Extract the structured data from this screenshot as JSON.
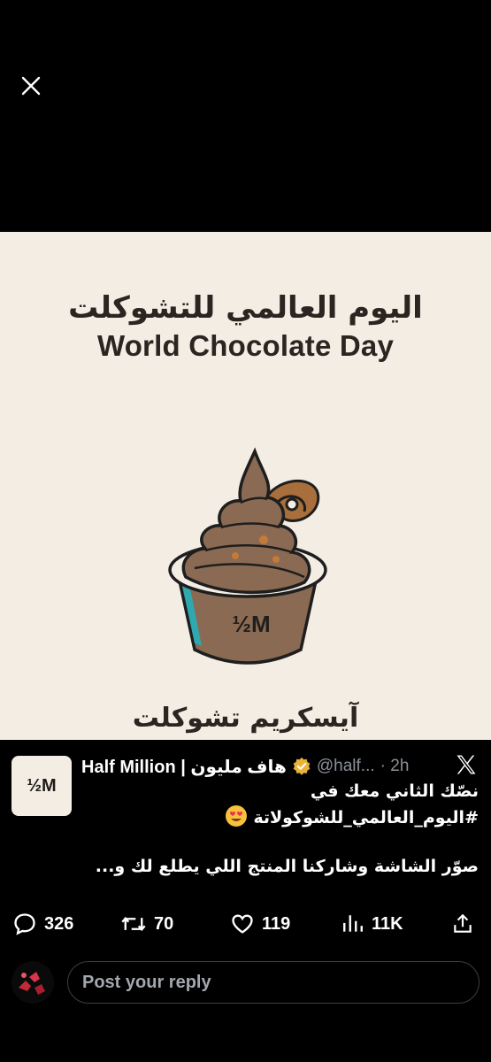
{
  "viewer": {
    "close_icon": "close-icon"
  },
  "media": {
    "title_ar": "اليوم العالمي للتشوكلت",
    "title_en": "World Chocolate Day",
    "cup_logo": "½M",
    "caption_ar": "آيسكريم تشوكلت",
    "colors": {
      "background": "#f4ede4",
      "chocolate": "#8a6a52",
      "outline": "#1e1e1e",
      "accent": "#2fa8b0"
    }
  },
  "tweet": {
    "avatar_text": "½M",
    "display_name": "Half Million | هاف مليون",
    "verified_icon": "verified-badge-icon",
    "handle": "@half...",
    "time": "· 2h",
    "platform_icon": "x-logo-icon",
    "line1": "نصّك الثاني معك في",
    "hashtag": "#اليوم_العالمي_للشوكولاتة",
    "emoji": "heart-eyes-emoji",
    "line2": "صوّر الشاشة وشاركنا المنتج اللي يطلع لك و..."
  },
  "actions": {
    "replies": "326",
    "reposts": "70",
    "likes": "119",
    "views": "11K"
  },
  "reply": {
    "placeholder": "Post your reply"
  }
}
